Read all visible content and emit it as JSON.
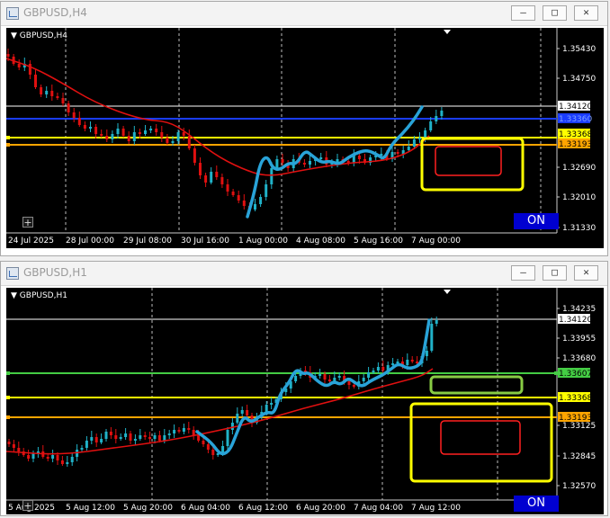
{
  "window1": {
    "title": "GBPUSD,H4",
    "symbol_label": "GBPUSD,H4",
    "on_label": "ON",
    "price_labels": [
      "1.35430",
      "1.34750",
      "1.34120",
      "1.33360",
      "1.33368",
      "1.33193",
      "1.32690",
      "1.32010",
      "1.31330"
    ],
    "time_labels": [
      "24 Jul 2025",
      "28 Jul 00:00",
      "29 Jul 08:00",
      "30 Jul 16:00",
      "1 Aug 00:00",
      "4 Aug 08:00",
      "5 Aug 16:00",
      "7 Aug 00:00"
    ]
  },
  "window2": {
    "title": "GBPUSD,H1",
    "symbol_label": "GBPUSD,H1",
    "on_label": "ON",
    "price_labels": [
      "1.34235",
      "1.34120",
      "1.33955",
      "1.33680",
      "1.33607",
      "1.33368",
      "1.33193",
      "1.33125",
      "1.32845",
      "1.32570"
    ],
    "time_labels": [
      "5 Aug 2025",
      "5 Aug 12:00",
      "5 Aug 20:00",
      "6 Aug 04:00",
      "6 Aug 12:00",
      "6 Aug 20:00",
      "7 Aug 04:00",
      "7 Aug 12:00"
    ]
  },
  "window_buttons": {
    "minimize": "—",
    "restore": "□",
    "close": "✕"
  },
  "colors": {
    "up": "#20b2c8",
    "down": "#e01010",
    "ma": "#e01010",
    "blue_line": "#1a3cff",
    "yellow": "#ffff00",
    "orange": "#ffa500",
    "green": "#44cc44",
    "trend": "#29a3d8"
  }
}
